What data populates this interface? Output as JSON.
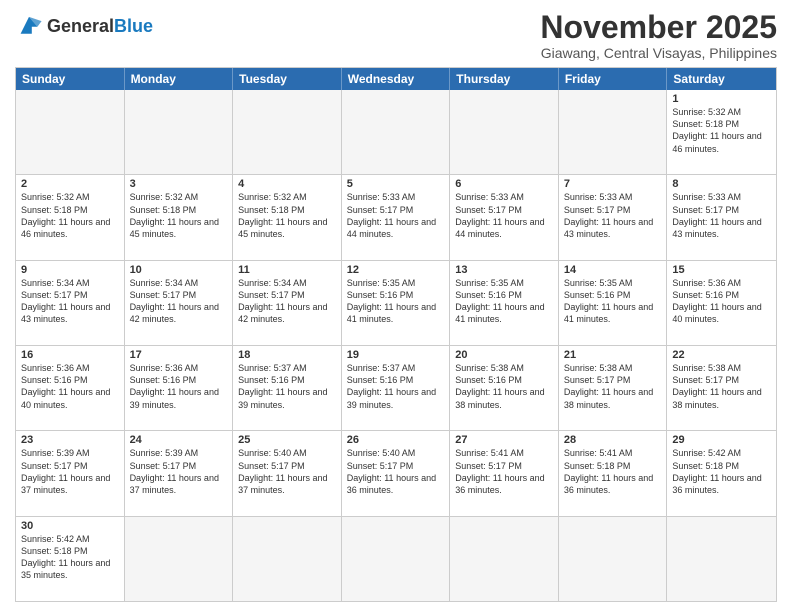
{
  "logo": {
    "text_general": "General",
    "text_blue": "Blue"
  },
  "title": "November 2025",
  "location": "Giawang, Central Visayas, Philippines",
  "header": {
    "days": [
      "Sunday",
      "Monday",
      "Tuesday",
      "Wednesday",
      "Thursday",
      "Friday",
      "Saturday"
    ]
  },
  "weeks": [
    {
      "cells": [
        {
          "day": "",
          "empty": true
        },
        {
          "day": "",
          "empty": true
        },
        {
          "day": "",
          "empty": true
        },
        {
          "day": "",
          "empty": true
        },
        {
          "day": "",
          "empty": true
        },
        {
          "day": "",
          "empty": true
        },
        {
          "day": "1",
          "sunrise": "Sunrise: 5:32 AM",
          "sunset": "Sunset: 5:18 PM",
          "daylight": "Daylight: 11 hours and 46 minutes."
        }
      ]
    },
    {
      "cells": [
        {
          "day": "2",
          "sunrise": "Sunrise: 5:32 AM",
          "sunset": "Sunset: 5:18 PM",
          "daylight": "Daylight: 11 hours and 46 minutes."
        },
        {
          "day": "3",
          "sunrise": "Sunrise: 5:32 AM",
          "sunset": "Sunset: 5:18 PM",
          "daylight": "Daylight: 11 hours and 45 minutes."
        },
        {
          "day": "4",
          "sunrise": "Sunrise: 5:32 AM",
          "sunset": "Sunset: 5:18 PM",
          "daylight": "Daylight: 11 hours and 45 minutes."
        },
        {
          "day": "5",
          "sunrise": "Sunrise: 5:33 AM",
          "sunset": "Sunset: 5:17 PM",
          "daylight": "Daylight: 11 hours and 44 minutes."
        },
        {
          "day": "6",
          "sunrise": "Sunrise: 5:33 AM",
          "sunset": "Sunset: 5:17 PM",
          "daylight": "Daylight: 11 hours and 44 minutes."
        },
        {
          "day": "7",
          "sunrise": "Sunrise: 5:33 AM",
          "sunset": "Sunset: 5:17 PM",
          "daylight": "Daylight: 11 hours and 43 minutes."
        },
        {
          "day": "8",
          "sunrise": "Sunrise: 5:33 AM",
          "sunset": "Sunset: 5:17 PM",
          "daylight": "Daylight: 11 hours and 43 minutes."
        }
      ]
    },
    {
      "cells": [
        {
          "day": "9",
          "sunrise": "Sunrise: 5:34 AM",
          "sunset": "Sunset: 5:17 PM",
          "daylight": "Daylight: 11 hours and 43 minutes."
        },
        {
          "day": "10",
          "sunrise": "Sunrise: 5:34 AM",
          "sunset": "Sunset: 5:17 PM",
          "daylight": "Daylight: 11 hours and 42 minutes."
        },
        {
          "day": "11",
          "sunrise": "Sunrise: 5:34 AM",
          "sunset": "Sunset: 5:17 PM",
          "daylight": "Daylight: 11 hours and 42 minutes."
        },
        {
          "day": "12",
          "sunrise": "Sunrise: 5:35 AM",
          "sunset": "Sunset: 5:16 PM",
          "daylight": "Daylight: 11 hours and 41 minutes."
        },
        {
          "day": "13",
          "sunrise": "Sunrise: 5:35 AM",
          "sunset": "Sunset: 5:16 PM",
          "daylight": "Daylight: 11 hours and 41 minutes."
        },
        {
          "day": "14",
          "sunrise": "Sunrise: 5:35 AM",
          "sunset": "Sunset: 5:16 PM",
          "daylight": "Daylight: 11 hours and 41 minutes."
        },
        {
          "day": "15",
          "sunrise": "Sunrise: 5:36 AM",
          "sunset": "Sunset: 5:16 PM",
          "daylight": "Daylight: 11 hours and 40 minutes."
        }
      ]
    },
    {
      "cells": [
        {
          "day": "16",
          "sunrise": "Sunrise: 5:36 AM",
          "sunset": "Sunset: 5:16 PM",
          "daylight": "Daylight: 11 hours and 40 minutes."
        },
        {
          "day": "17",
          "sunrise": "Sunrise: 5:36 AM",
          "sunset": "Sunset: 5:16 PM",
          "daylight": "Daylight: 11 hours and 39 minutes."
        },
        {
          "day": "18",
          "sunrise": "Sunrise: 5:37 AM",
          "sunset": "Sunset: 5:16 PM",
          "daylight": "Daylight: 11 hours and 39 minutes."
        },
        {
          "day": "19",
          "sunrise": "Sunrise: 5:37 AM",
          "sunset": "Sunset: 5:16 PM",
          "daylight": "Daylight: 11 hours and 39 minutes."
        },
        {
          "day": "20",
          "sunrise": "Sunrise: 5:38 AM",
          "sunset": "Sunset: 5:16 PM",
          "daylight": "Daylight: 11 hours and 38 minutes."
        },
        {
          "day": "21",
          "sunrise": "Sunrise: 5:38 AM",
          "sunset": "Sunset: 5:17 PM",
          "daylight": "Daylight: 11 hours and 38 minutes."
        },
        {
          "day": "22",
          "sunrise": "Sunrise: 5:38 AM",
          "sunset": "Sunset: 5:17 PM",
          "daylight": "Daylight: 11 hours and 38 minutes."
        }
      ]
    },
    {
      "cells": [
        {
          "day": "23",
          "sunrise": "Sunrise: 5:39 AM",
          "sunset": "Sunset: 5:17 PM",
          "daylight": "Daylight: 11 hours and 37 minutes."
        },
        {
          "day": "24",
          "sunrise": "Sunrise: 5:39 AM",
          "sunset": "Sunset: 5:17 PM",
          "daylight": "Daylight: 11 hours and 37 minutes."
        },
        {
          "day": "25",
          "sunrise": "Sunrise: 5:40 AM",
          "sunset": "Sunset: 5:17 PM",
          "daylight": "Daylight: 11 hours and 37 minutes."
        },
        {
          "day": "26",
          "sunrise": "Sunrise: 5:40 AM",
          "sunset": "Sunset: 5:17 PM",
          "daylight": "Daylight: 11 hours and 36 minutes."
        },
        {
          "day": "27",
          "sunrise": "Sunrise: 5:41 AM",
          "sunset": "Sunset: 5:17 PM",
          "daylight": "Daylight: 11 hours and 36 minutes."
        },
        {
          "day": "28",
          "sunrise": "Sunrise: 5:41 AM",
          "sunset": "Sunset: 5:18 PM",
          "daylight": "Daylight: 11 hours and 36 minutes."
        },
        {
          "day": "29",
          "sunrise": "Sunrise: 5:42 AM",
          "sunset": "Sunset: 5:18 PM",
          "daylight": "Daylight: 11 hours and 36 minutes."
        }
      ]
    },
    {
      "cells": [
        {
          "day": "30",
          "sunrise": "Sunrise: 5:42 AM",
          "sunset": "Sunset: 5:18 PM",
          "daylight": "Daylight: 11 hours and 35 minutes."
        },
        {
          "day": "",
          "empty": true
        },
        {
          "day": "",
          "empty": true
        },
        {
          "day": "",
          "empty": true
        },
        {
          "day": "",
          "empty": true
        },
        {
          "day": "",
          "empty": true
        },
        {
          "day": "",
          "empty": true
        }
      ]
    }
  ]
}
